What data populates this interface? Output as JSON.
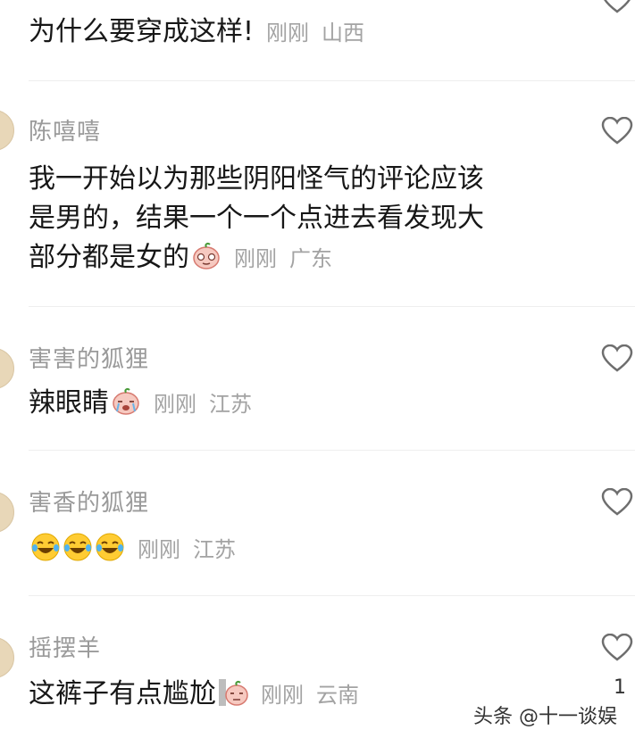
{
  "comments": [
    {
      "text": "为什么要穿成这样!",
      "time": "刚刚",
      "location": "山西"
    },
    {
      "username": "陈嘻嘻",
      "text_lines": [
        "我一开始以为那些阴阳怪气的评论应该",
        "是男的，结果一个一个点进去看发现大",
        "部分都是女的"
      ],
      "time": "刚刚",
      "location": "广东",
      "emoji": "sly-peach-emoji"
    },
    {
      "username": "害害的狐狸",
      "text": "辣眼睛",
      "time": "刚刚",
      "location": "江苏",
      "emoji": "crying-peach-emoji"
    },
    {
      "username": "害香的狐狸",
      "text": "",
      "time": "刚刚",
      "location": "江苏",
      "emoji": "laugh-cry-emoji x3"
    },
    {
      "username": "摇摆羊",
      "text": "这裤子有点尴尬",
      "time": "刚刚",
      "location": "云南",
      "emoji": "awkward-peach-emoji",
      "like_count": "1"
    }
  ],
  "watermark": "头条 @十一谈娱",
  "colors": {
    "meta": "#a3a3a3",
    "username": "#9a9a9a",
    "text": "#171717",
    "heart": "#6e6e6e"
  }
}
